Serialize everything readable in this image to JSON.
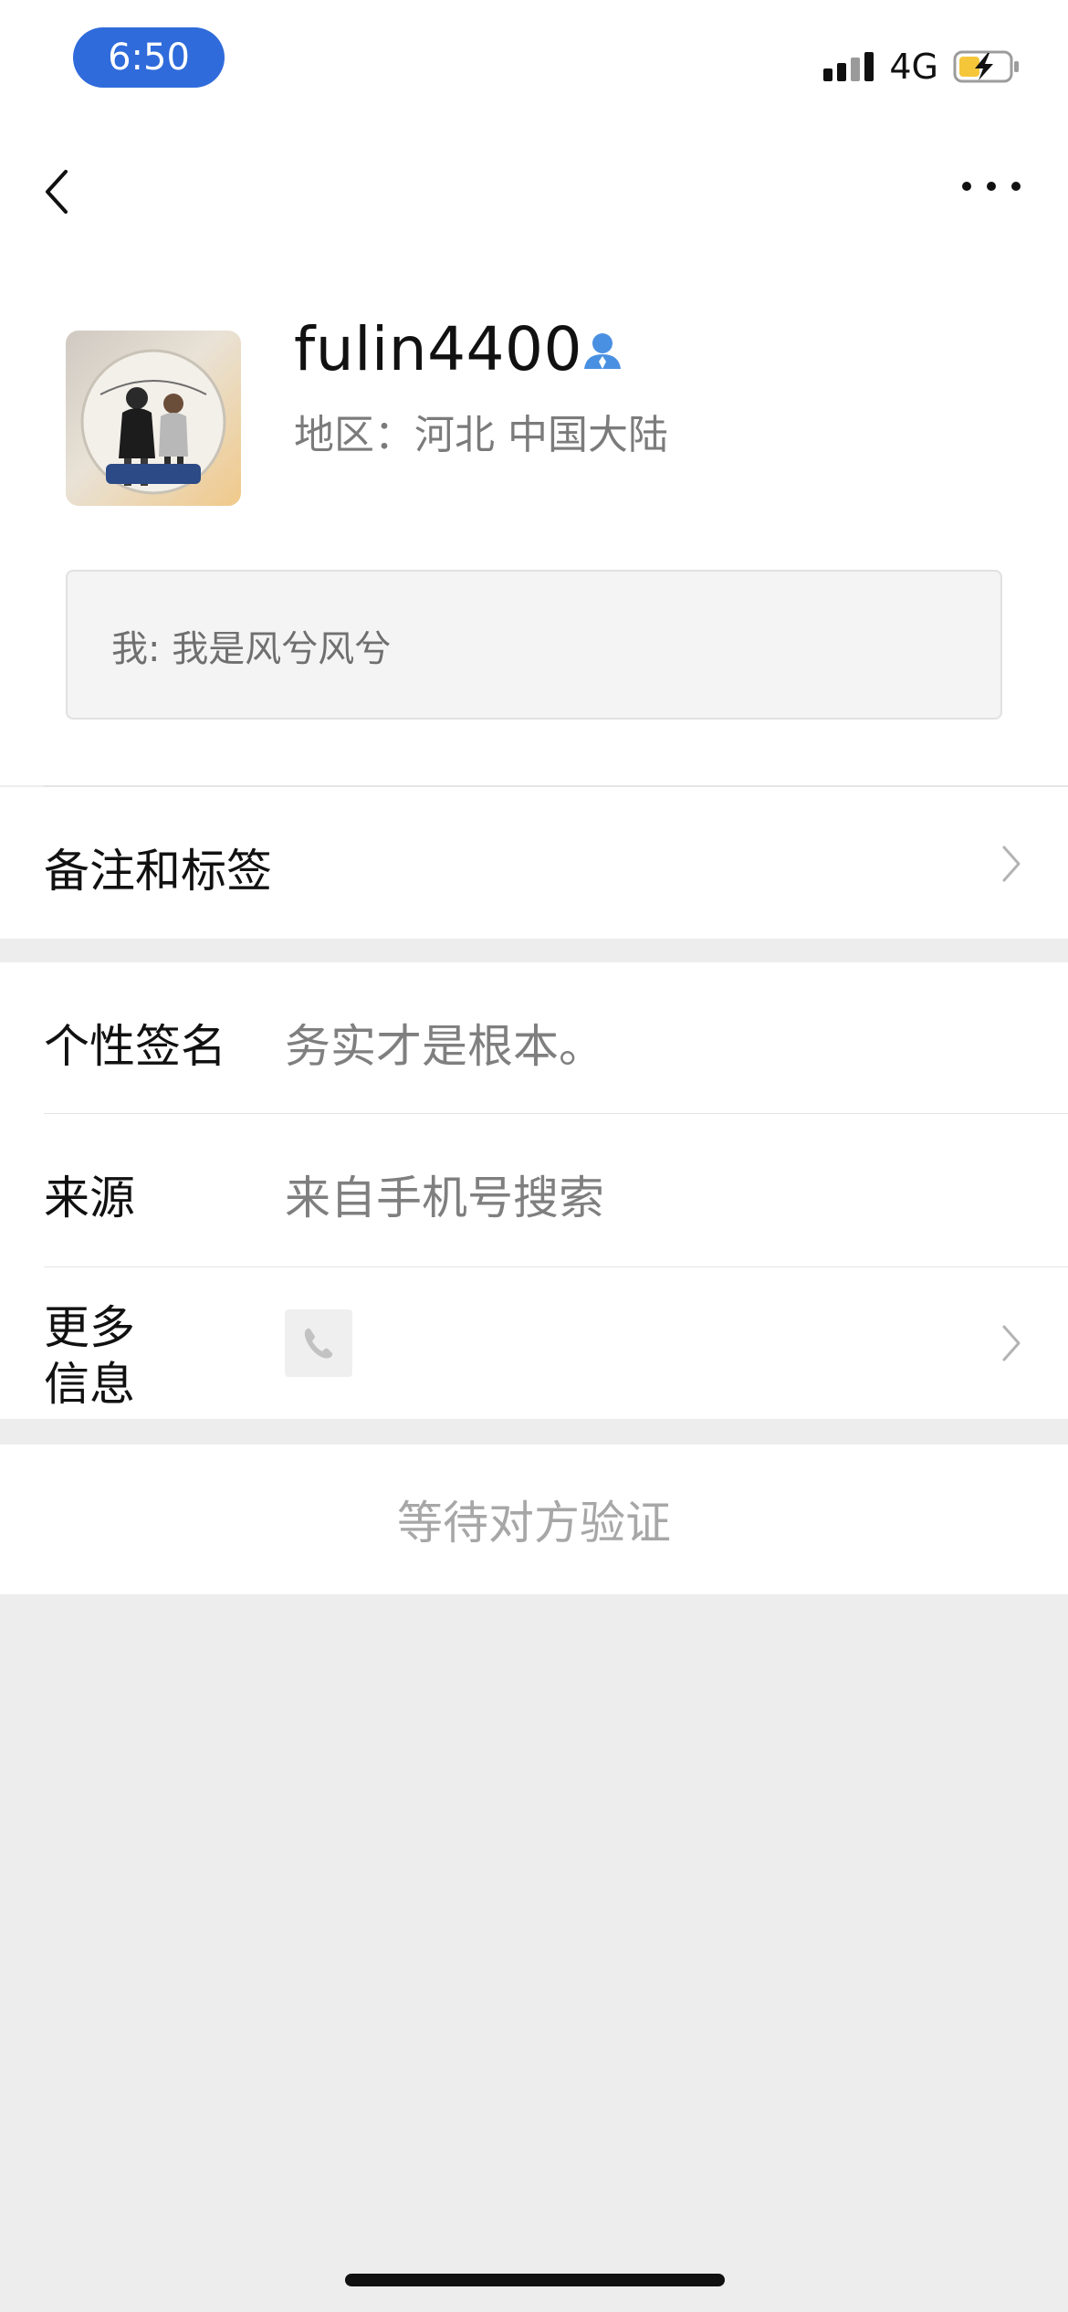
{
  "status_bar": {
    "time": "6:50",
    "network": "4G",
    "time_pill_color": "#2f6bdb",
    "battery_color": "#f5c63a"
  },
  "nav": {
    "back_icon": "chevron-left-icon",
    "more_icon": "ellipsis-icon"
  },
  "profile": {
    "nickname": "fulin4400",
    "region": "地区：河北 中国大陆",
    "friend_request_message": "我: 我是风兮风兮"
  },
  "rows": {
    "remark": {
      "label": "备注和标签"
    },
    "signature": {
      "label": "个性签名",
      "value": "务实才是根本。"
    },
    "source": {
      "label": "来源",
      "value": "来自手机号搜索"
    },
    "more_info": {
      "label_line1": "更多",
      "label_line2": "信息",
      "icon": "phone-icon"
    }
  },
  "footer": {
    "waiting_verification": "等待对方验证"
  }
}
